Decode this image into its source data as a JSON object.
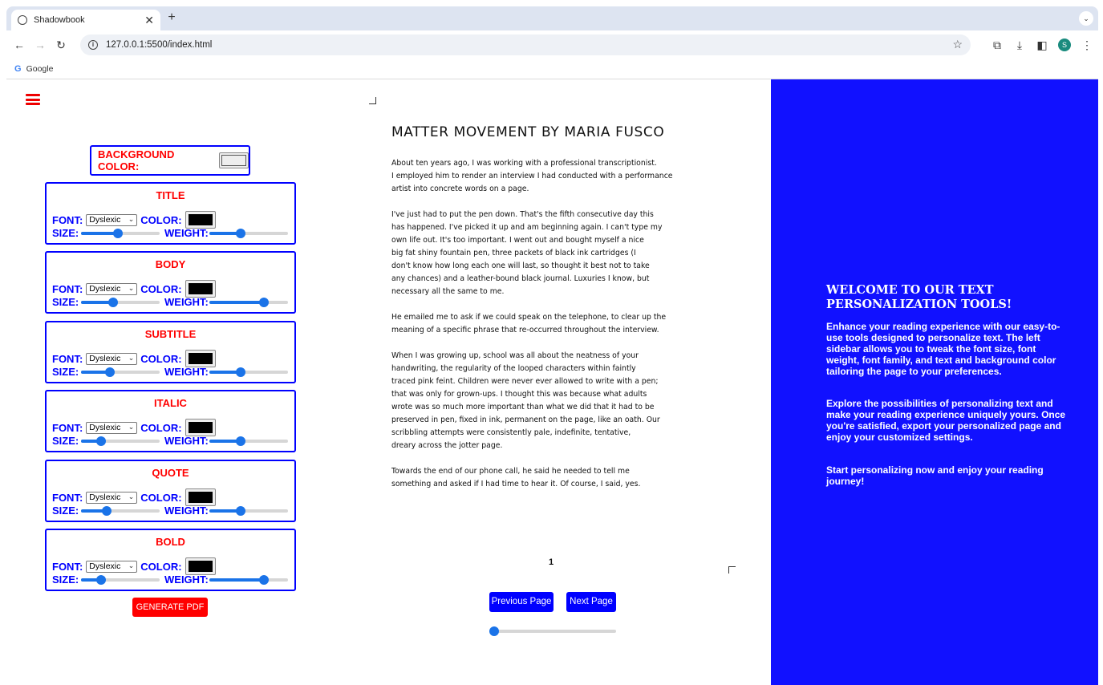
{
  "browser": {
    "tab_title": "Shadowbook",
    "new_tab_symbol": "+",
    "url": "127.0.0.1:5500/index.html",
    "bookmark_label": "Google",
    "profile_initial": "S"
  },
  "sidebar": {
    "background_color_label": "BACKGROUND COLOR:",
    "font_label": "FONT:",
    "color_label": "COLOR:",
    "size_label": "SIZE:",
    "weight_label": "WEIGHT:",
    "panels": [
      {
        "title": "TITLE",
        "font": "Dyslexic",
        "color": "#000000",
        "size_level": 0.47,
        "weight_level": 0.38
      },
      {
        "title": "BODY",
        "font": "Dyslexic",
        "color": "#000000",
        "size_level": 0.4,
        "weight_level": 0.72
      },
      {
        "title": "SUBTITLE",
        "font": "Dyslexic",
        "color": "#000000",
        "size_level": 0.35,
        "weight_level": 0.38
      },
      {
        "title": "ITALIC",
        "font": "Dyslexic",
        "color": "#000000",
        "size_level": 0.22,
        "weight_level": 0.38
      },
      {
        "title": "QUOTE",
        "font": "Dyslexic",
        "color": "#000000",
        "size_level": 0.3,
        "weight_level": 0.38
      },
      {
        "title": "BOLD",
        "font": "Dyslexic",
        "color": "#000000",
        "size_level": 0.22,
        "weight_level": 0.72
      }
    ],
    "generate_pdf_label": "GENERATE PDF"
  },
  "reader": {
    "title": "MATTER MOVEMENT BY MARIA FUSCO",
    "paragraphs": [
      "About ten years ago, I was working with a professional transcriptionist.\nI employed him to render an interview I had conducted with a performance\nartist into concrete words on a page.",
      "I've just had to put the pen down. That's the fifth consecutive day this\nhas happened. I've picked it up and am beginning again. I can't type my\nown life out. It's too important. I went out and bought myself a nice\nbig fat shiny fountain pen, three packets of black ink cartridges (I\ndon't know how long each one will last, so thought it best not to take\nany chances) and a leather-bound black journal. Luxuries I know, but\nnecessary all the same to me.",
      "He emailed me to ask if we could speak on the telephone, to clear up the\nmeaning of a specific phrase that re-occurred throughout the interview.",
      "When I was growing up, school was all about the neatness of your\nhandwriting, the regularity of the looped characters within faintly\ntraced pink feint. Children were never ever allowed to write with a pen;\nthat was only for grown-ups. I thought this was because what adults\nwrote was so much more important than what we did that it had to be\npreserved in pen, fixed in ink, permanent on the page, like an oath. Our\nscribbling attempts were consistently pale, indefinite, tentative,\ndreary across the jotter page.",
      "Towards the end of our phone call, he said he needed to tell me\nsomething and asked if I had time to hear it. Of course, I said, yes."
    ],
    "page_number": "1",
    "previous_label": "Previous Page",
    "next_label": "Next Page",
    "page_slider_level": 0.0
  },
  "welcome": {
    "heading": "WELCOME TO OUR TEXT PERSONALIZATION TOOLS!",
    "p1": "Enhance your reading experience with our easy-to-use tools designed to personalize text. The left sidebar allows you to tweak the font size, font weight, font family, and text and background color tailoring the page to your preferences.",
    "p2": "Explore the possibilities of personalizing text and make your reading experience uniquely yours. Once you're satisfied, export your personalized page and enjoy your customized settings.",
    "p3": "Start personalizing now and enjoy your reading journey!"
  },
  "colors": {
    "accent_blue": "#0000ff",
    "label_red": "#ff0000",
    "panel_bg": "#1111ff",
    "slider_blue": "#1a73e8"
  }
}
